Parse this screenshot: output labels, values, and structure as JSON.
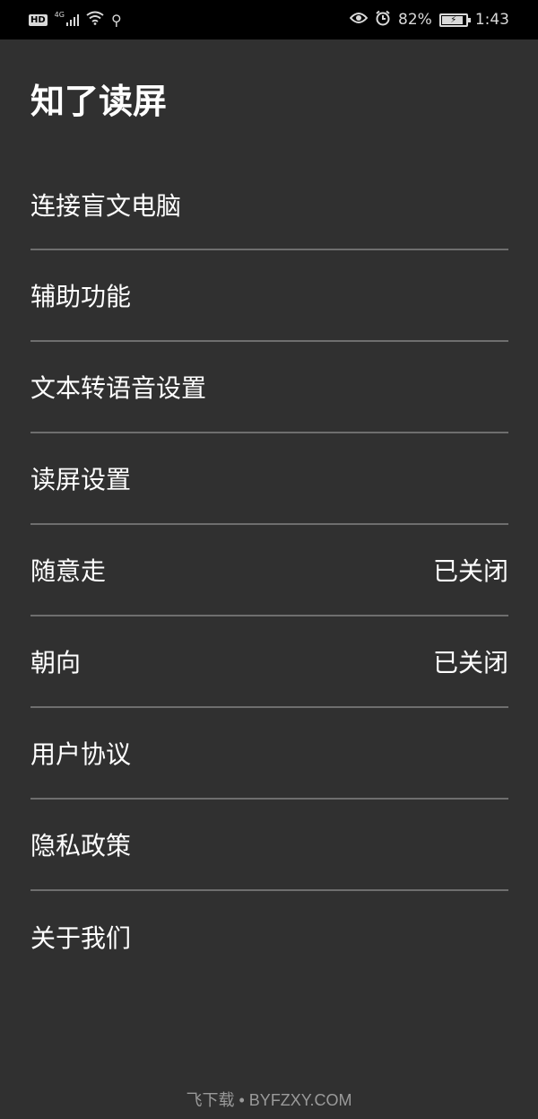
{
  "status_bar": {
    "hd": "HD",
    "network": "4G",
    "usb_icon": "usb-icon",
    "eye_icon": "eye-comfort-icon",
    "alarm_icon": "alarm-icon",
    "battery_percent": "82%",
    "battery_level": 0.82,
    "time": "1:43"
  },
  "app": {
    "title": "知了读屏"
  },
  "menu": {
    "items": [
      {
        "label": "连接盲文电脑",
        "value": ""
      },
      {
        "label": "辅助功能",
        "value": ""
      },
      {
        "label": "文本转语音设置",
        "value": ""
      },
      {
        "label": "读屏设置",
        "value": ""
      },
      {
        "label": "随意走",
        "value": "已关闭"
      },
      {
        "label": "朝向",
        "value": "已关闭"
      },
      {
        "label": "用户协议",
        "value": ""
      },
      {
        "label": "隐私政策",
        "value": ""
      },
      {
        "label": "关于我们",
        "value": ""
      }
    ]
  },
  "watermark": "飞下载 • BYFZXY.COM",
  "colors": {
    "background": "#303030",
    "status_bar": "#000000",
    "divider": "#6e6e6e",
    "text": "#ffffff"
  }
}
